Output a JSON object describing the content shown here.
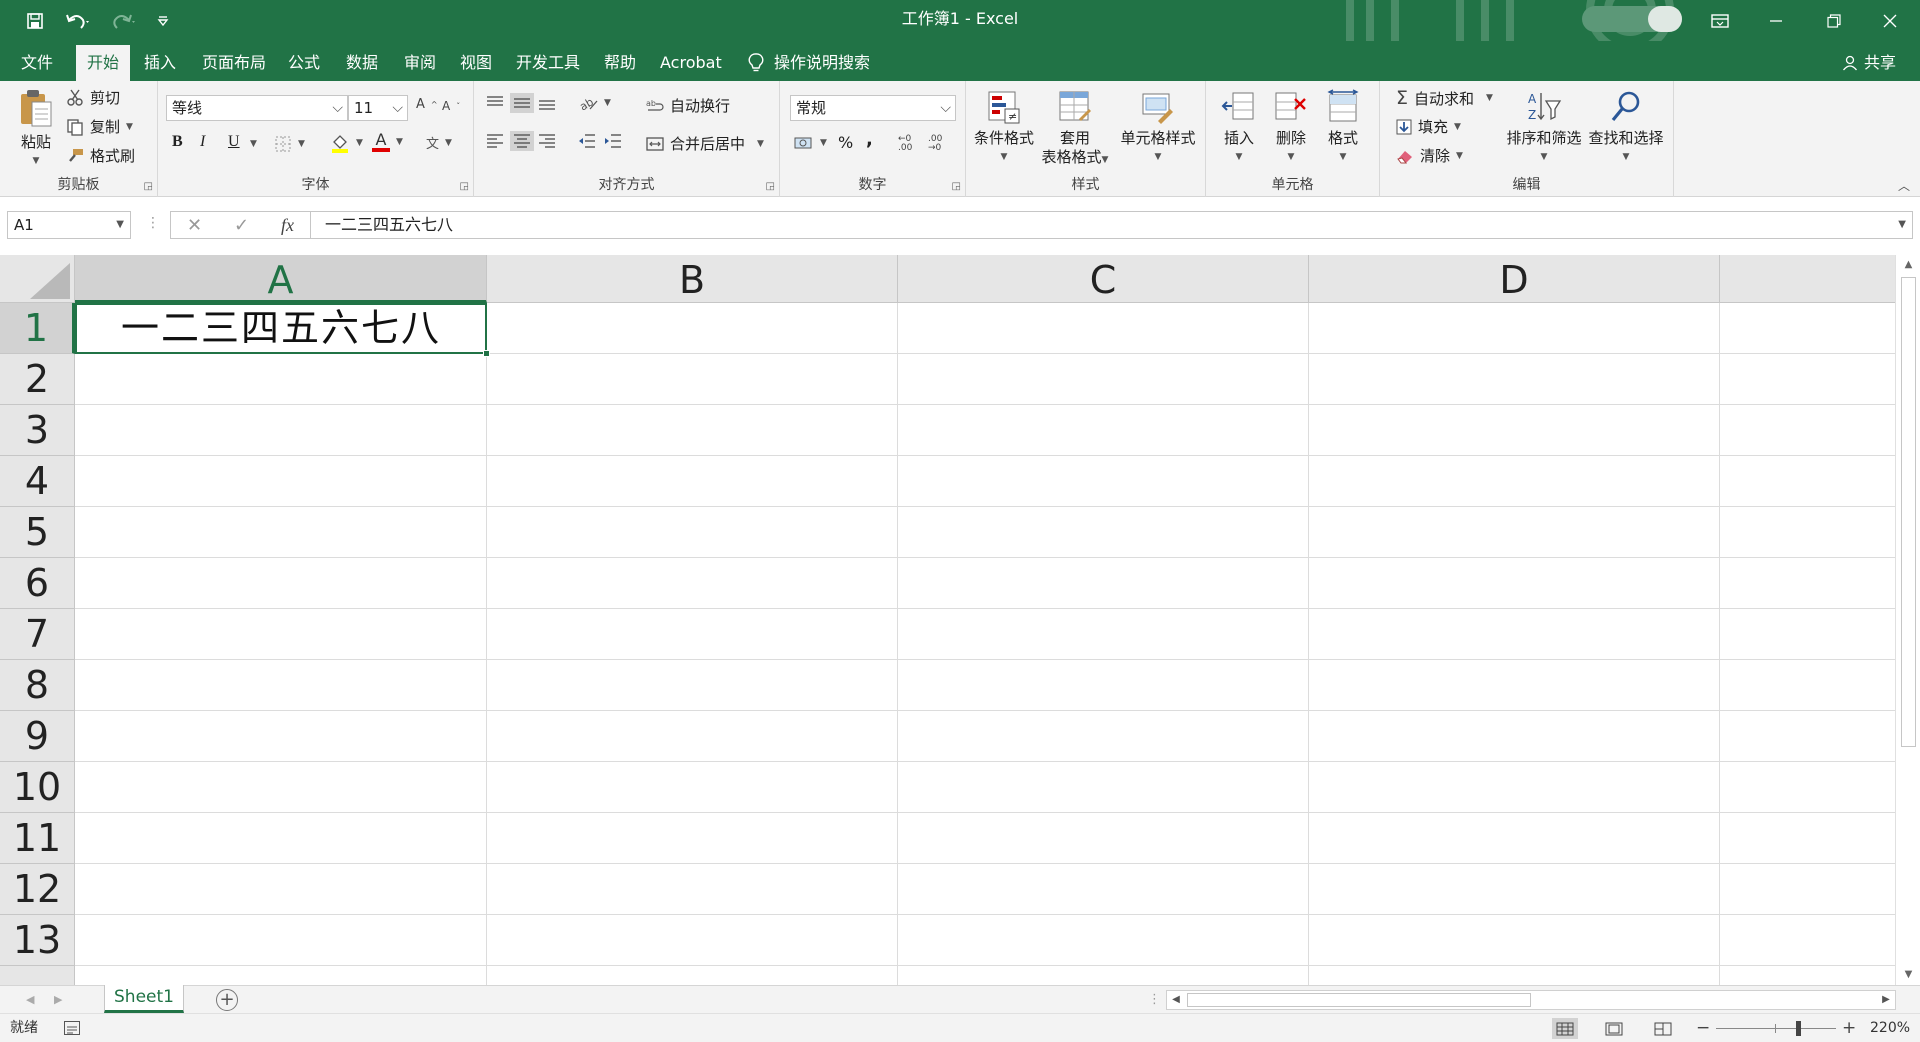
{
  "window": {
    "title": "工作簿1  -  Excel",
    "colors": {
      "accent": "#217346",
      "ribbon_bg": "#f3f3f3",
      "header_bg": "#e6e6e6"
    }
  },
  "quick_access": {
    "save_icon": "save-icon",
    "undo_icon": "undo-icon",
    "redo_icon": "redo-icon",
    "customize_icon": "customize-toolbar-icon"
  },
  "menu": {
    "tabs": [
      "文件",
      "开始",
      "插入",
      "页面布局",
      "公式",
      "数据",
      "审阅",
      "视图",
      "开发工具",
      "帮助",
      "Acrobat"
    ],
    "active_tab": "开始",
    "tell_me": "操作说明搜索",
    "share": "共享"
  },
  "ribbon": {
    "clipboard": {
      "label": "剪贴板",
      "paste": "粘贴",
      "cut": "剪切",
      "copy": "复制",
      "format_painter": "格式刷"
    },
    "font": {
      "label": "字体",
      "font_name": "等线",
      "font_size": "11",
      "bold": "B",
      "italic": "I",
      "underline": "U",
      "font_color_letter": "A",
      "phonetic": "文"
    },
    "alignment": {
      "label": "对齐方式",
      "wrap_text": "自动换行",
      "merge_center": "合并后居中"
    },
    "number": {
      "label": "数字",
      "format": "常规",
      "percent": "%",
      "comma": ","
    },
    "styles": {
      "label": "样式",
      "conditional": "条件格式",
      "table_format_line1": "套用",
      "table_format_line2": "表格格式",
      "cell_styles": "单元格样式"
    },
    "cells": {
      "label": "单元格",
      "insert": "插入",
      "delete": "删除",
      "format": "格式"
    },
    "editing": {
      "label": "编辑",
      "autosum": "自动求和",
      "fill": "填充",
      "clear": "清除",
      "sort_filter": "排序和筛选",
      "find_select": "查找和选择"
    }
  },
  "formula_bar": {
    "name_box": "A1",
    "fx": "fx",
    "value": "一二三四五六七八"
  },
  "grid": {
    "columns": [
      "A",
      "B",
      "C",
      "D"
    ],
    "rows": [
      "1",
      "2",
      "3",
      "4",
      "5",
      "6",
      "7",
      "8",
      "9",
      "10",
      "11",
      "12",
      "13"
    ],
    "active_cell": "A1",
    "cells": {
      "A1": "一二三四五六七八"
    }
  },
  "sheets": {
    "tabs": [
      "Sheet1"
    ],
    "active": "Sheet1"
  },
  "status": {
    "ready": "就绪",
    "zoom_minus": "−",
    "zoom_plus": "+",
    "zoom": "220%"
  }
}
